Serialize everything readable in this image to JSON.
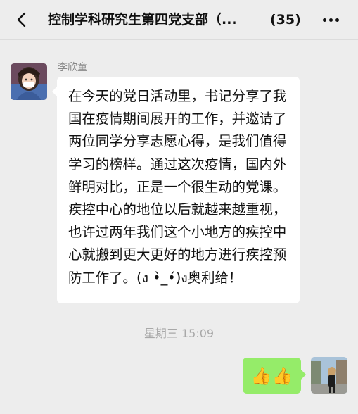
{
  "header": {
    "title": "控制学科研究生第四党支部（...",
    "member_count": "(35)",
    "back_icon": "chevron-left-icon",
    "more_icon": "more-horizontal-icon"
  },
  "messages": [
    {
      "sender": "李欣童",
      "text": "在今天的党日活动里，书记分享了我国在疫情期间展开的工作，并邀请了两位同学分享志愿心得，是我们值得学习的榜样。通过这次疫情，国内外鲜明对比，正是一个很生动的党课。疾控中心的地位以后就越来越重视，也许过两年我们这个小地方的疾控中心就搬到更大更好的地方进行疾控预防工作了。(ง •̀_•́)ง奥利给！"
    }
  ],
  "timestamp": "星期三 15:09",
  "reply": {
    "text": "👍👍"
  },
  "colors": {
    "background": "#ededed",
    "bubble_left": "#ffffff",
    "bubble_right": "#95ec69"
  }
}
